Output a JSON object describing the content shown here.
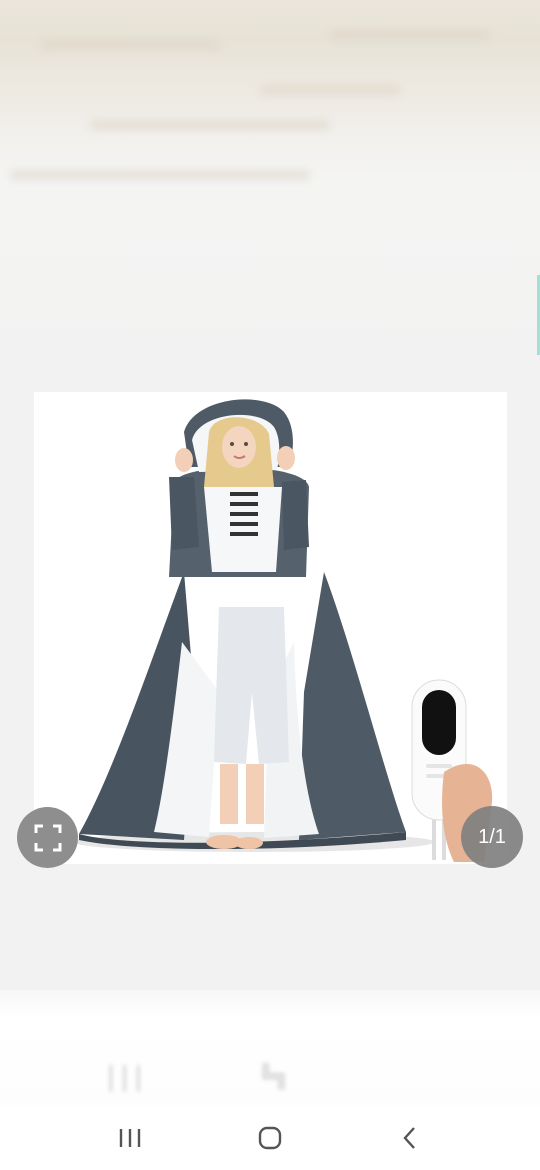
{
  "viewer": {
    "image_description_icon": "product-photo",
    "counter_text": "1/1"
  },
  "controls": {
    "fullscreen_icon": "fullscreen-icon"
  },
  "navbar": {
    "recent_icon": "recent-apps-icon",
    "home_icon": "home-icon",
    "back_icon": "back-icon"
  },
  "colors": {
    "blanket": "#4b5863",
    "sherpa": "#f4f6f8",
    "badge_bg": "#8e8e8e"
  }
}
